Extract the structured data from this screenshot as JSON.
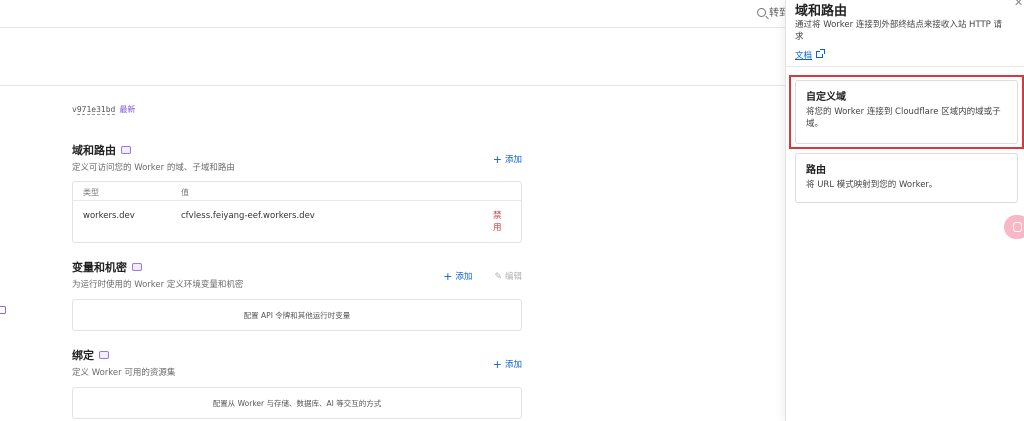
{
  "search": {
    "label": "转到"
  },
  "version": {
    "hash": "971e31bd",
    "prefix": "v",
    "latest": "最新"
  },
  "domains": {
    "title": "域和路由",
    "desc": "定义可访问您的 Worker 的域、子域和路由",
    "add": "添加",
    "columns": [
      "类型",
      "值"
    ],
    "rows": [
      {
        "type": "workers.dev",
        "value": "cfvless.feiyang-eef.workers.dev",
        "action": "禁用"
      }
    ]
  },
  "variables": {
    "title": "变量和机密",
    "desc": "为运行时使用的 Worker 定义环境变量和机密",
    "add": "添加",
    "edit": "编辑",
    "empty": "配置 API 令牌和其他运行时变量"
  },
  "bindings": {
    "title": "绑定",
    "desc": "定义 Worker 可用的资源集",
    "add": "添加",
    "empty": "配置从 Worker 与存储、数据库、AI 等交互的方式"
  },
  "panel": {
    "title": "域和路由",
    "desc": "通过将 Worker 连接到外部终结点来接收入站 HTTP 请求",
    "docs": "文档",
    "options": [
      {
        "title": "自定义域",
        "desc": "将您的 Worker 连接到 Cloudflare 区域内的域或子域。"
      },
      {
        "title": "路由",
        "desc": "将 URL 模式映射到您的 Worker。"
      }
    ]
  }
}
